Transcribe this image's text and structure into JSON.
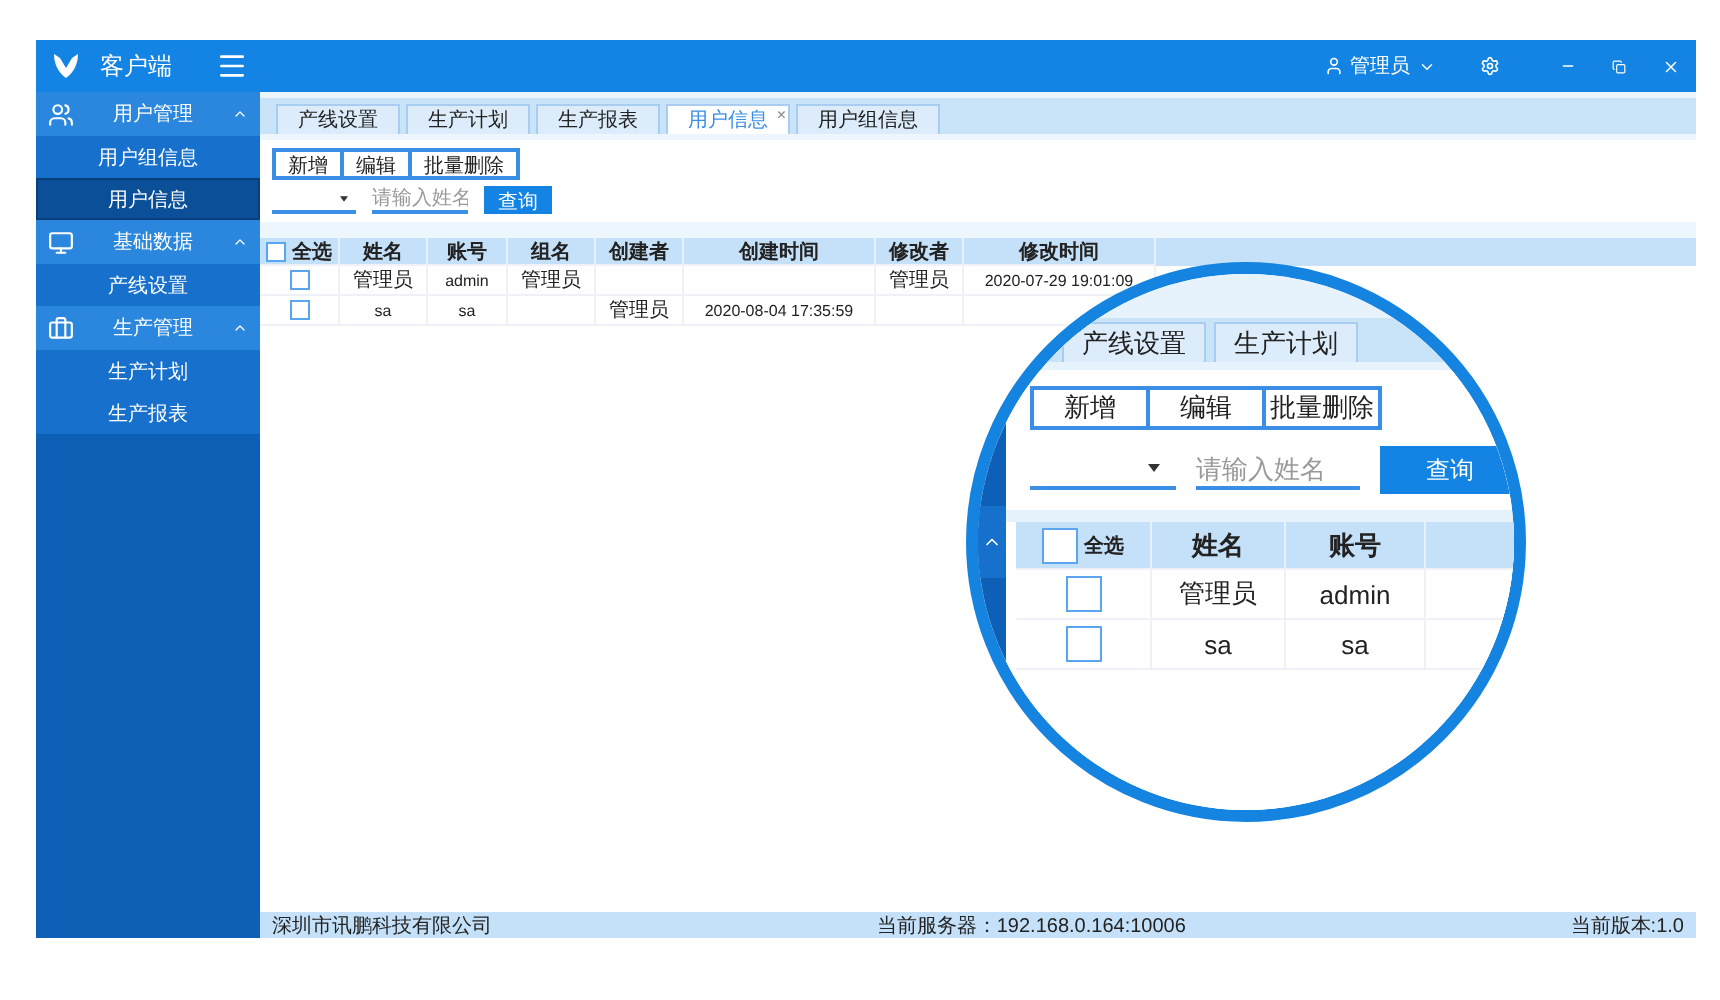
{
  "app": {
    "title": "客户端",
    "user": "管理员"
  },
  "sidebar": [
    {
      "label": "用户管理",
      "kind": "users",
      "expanded": true,
      "children": [
        {
          "label": "用户组信息",
          "selected": false
        },
        {
          "label": "用户信息",
          "selected": true
        }
      ]
    },
    {
      "label": "基础数据",
      "kind": "monitor",
      "expanded": true,
      "children": [
        {
          "label": "产线设置",
          "selected": false
        }
      ]
    },
    {
      "label": "生产管理",
      "kind": "briefcase",
      "expanded": true,
      "children": [
        {
          "label": "生产计划",
          "selected": false
        },
        {
          "label": "生产报表",
          "selected": false
        }
      ]
    }
  ],
  "tabs": [
    {
      "label": "产线设置",
      "selected": false
    },
    {
      "label": "生产计划",
      "selected": false
    },
    {
      "label": "生产报表",
      "selected": false
    },
    {
      "label": "用户信息",
      "selected": true,
      "close": "×"
    },
    {
      "label": "用户组信息",
      "selected": false
    }
  ],
  "toolbar": [
    "新增",
    "编辑",
    "批量删除"
  ],
  "search": {
    "placeholder": "请输入姓名",
    "button": "查询"
  },
  "table": {
    "select_all": {
      "label": "全选",
      "checked": false
    },
    "columns": [
      "姓名",
      "账号",
      "组名",
      "创建者",
      "创建时间",
      "修改者",
      "修改时间"
    ],
    "rows": [
      {
        "checked": false,
        "cells": [
          "管理员",
          "admin",
          "管理员",
          null,
          null,
          "管理员",
          "2020-07-29 19:01:09"
        ]
      },
      {
        "checked": false,
        "cells": [
          "sa",
          "sa",
          null,
          "管理员",
          "2020-08-04 17:35:59",
          null,
          null
        ]
      }
    ]
  },
  "status_bar": {
    "company": "深圳市讯鹏科技有限公司",
    "server": "当前服务器：192.168.0.164:10006",
    "version": "当前版本:1.0"
  },
  "magnifier": {
    "tabs": [
      "产线设置",
      "生产计划"
    ],
    "toolbar": [
      "新增",
      "编辑",
      "批量删除"
    ],
    "search": {
      "placeholder": "请输入姓名",
      "button": "查询"
    },
    "table": {
      "select_all": {
        "label": "全选",
        "checked": false
      },
      "columns": [
        "姓名",
        "账号"
      ],
      "rows": [
        {
          "checked": false,
          "cells": [
            "管理员",
            "admin"
          ]
        },
        {
          "checked": false,
          "cells": [
            "sa",
            "sa"
          ]
        }
      ]
    }
  }
}
